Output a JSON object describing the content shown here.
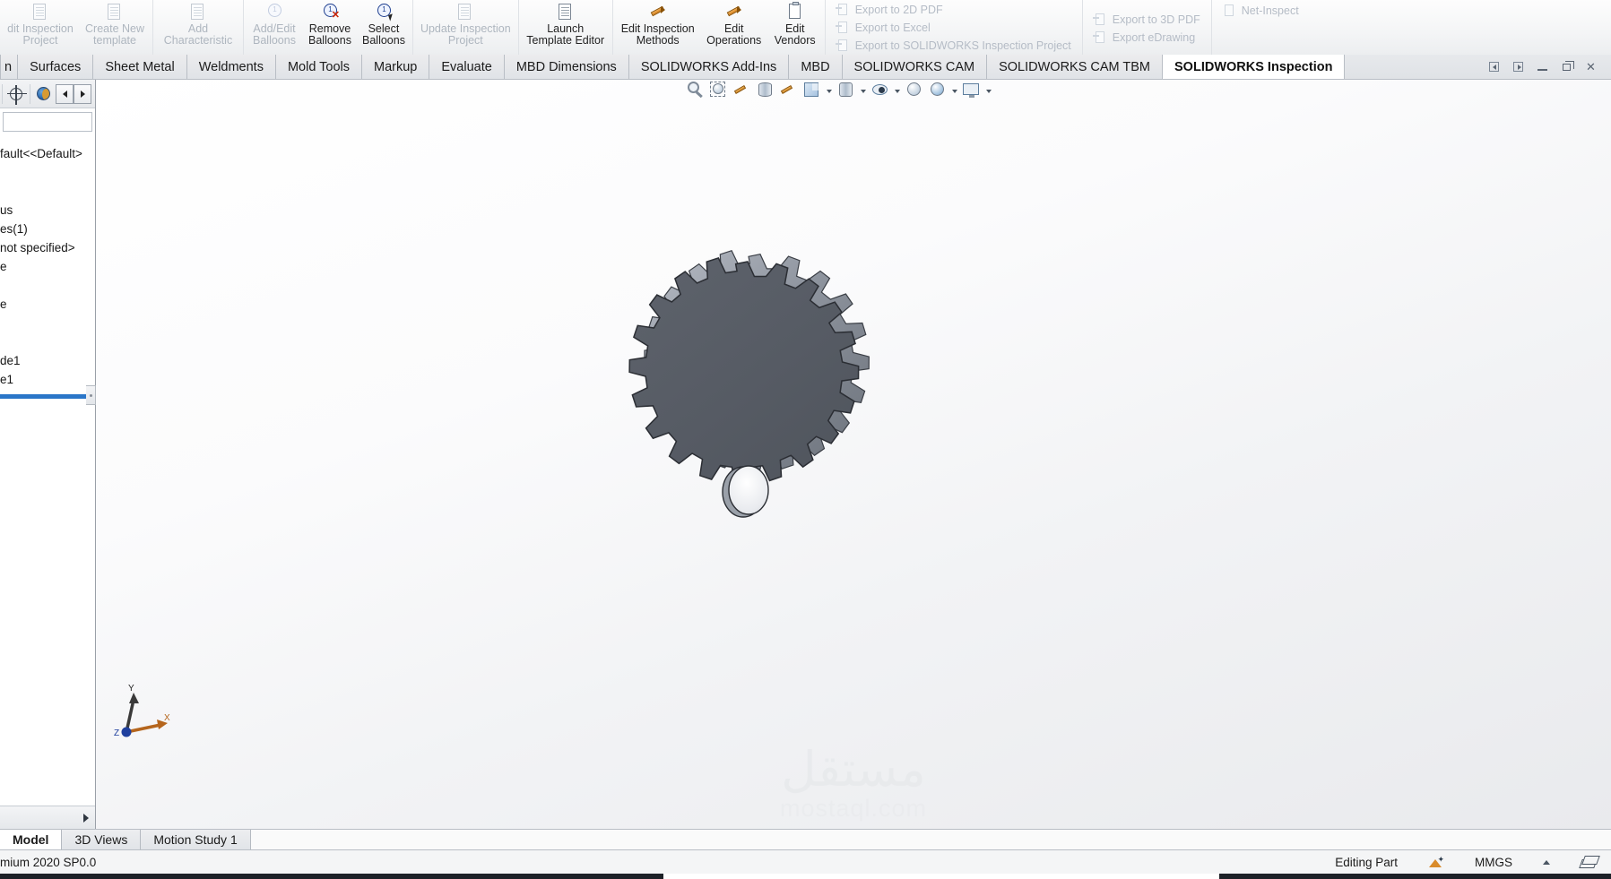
{
  "ribbon": {
    "groups": [
      {
        "name": "inspection-project-group",
        "buttons": [
          {
            "label": "dit Inspection\nProject",
            "icon": "edit-inspection-project-icon",
            "enabled": false
          },
          {
            "label": "Create New\ntemplate",
            "icon": "create-new-template-icon",
            "enabled": false
          }
        ]
      },
      {
        "name": "characteristic-group",
        "buttons": [
          {
            "label": "Add\nCharacteristic",
            "icon": "add-characteristic-icon",
            "enabled": false
          }
        ]
      },
      {
        "name": "balloons-group",
        "buttons": [
          {
            "label": "Add/Edit\nBalloons",
            "icon": "add-edit-balloons-icon",
            "enabled": false
          },
          {
            "label": "Remove\nBalloons",
            "icon": "remove-balloons-icon",
            "enabled": true
          },
          {
            "label": "Select\nBalloons",
            "icon": "select-balloons-icon",
            "enabled": true
          }
        ]
      },
      {
        "name": "update-group",
        "buttons": [
          {
            "label": "Update Inspection\nProject",
            "icon": "update-inspection-project-icon",
            "enabled": false
          }
        ]
      },
      {
        "name": "template-editor-group",
        "buttons": [
          {
            "label": "Launch\nTemplate Editor",
            "icon": "launch-template-editor-icon",
            "enabled": true
          }
        ]
      },
      {
        "name": "edit-group",
        "buttons": [
          {
            "label": "Edit Inspection\nMethods",
            "icon": "edit-inspection-methods-icon",
            "enabled": true
          },
          {
            "label": "Edit\nOperations",
            "icon": "edit-operations-icon",
            "enabled": true
          },
          {
            "label": "Edit\nVendors",
            "icon": "edit-vendors-icon",
            "enabled": true
          }
        ]
      }
    ],
    "export_column_1": [
      {
        "label": "Export to 2D PDF",
        "icon": "export-2d-pdf-icon",
        "enabled": false
      },
      {
        "label": "Export to Excel",
        "icon": "export-excel-icon",
        "enabled": false
      },
      {
        "label": "Export to SOLIDWORKS Inspection Project",
        "icon": "export-sw-inspection-icon",
        "enabled": false
      }
    ],
    "export_column_2": [
      {
        "label": "Export to 3D PDF",
        "icon": "export-3d-pdf-icon",
        "enabled": false
      },
      {
        "label": "Export eDrawing",
        "icon": "export-edrawing-icon",
        "enabled": false
      }
    ],
    "export_column_3": [
      {
        "label": "Net-Inspect",
        "icon": "net-inspect-icon",
        "enabled": false
      }
    ]
  },
  "tabs": {
    "items": [
      {
        "label": "n",
        "active": false,
        "partial": true
      },
      {
        "label": "Surfaces",
        "active": false
      },
      {
        "label": "Sheet Metal",
        "active": false
      },
      {
        "label": "Weldments",
        "active": false
      },
      {
        "label": "Mold Tools",
        "active": false
      },
      {
        "label": "Markup",
        "active": false
      },
      {
        "label": "Evaluate",
        "active": false
      },
      {
        "label": "MBD Dimensions",
        "active": false
      },
      {
        "label": "SOLIDWORKS Add-Ins",
        "active": false
      },
      {
        "label": "MBD",
        "active": false
      },
      {
        "label": "SOLIDWORKS CAM",
        "active": false
      },
      {
        "label": "SOLIDWORKS CAM TBM",
        "active": false
      },
      {
        "label": "SOLIDWORKS Inspection",
        "active": true
      }
    ],
    "window_controls": [
      {
        "name": "restore-prev-doc-button",
        "glyph": "prev"
      },
      {
        "name": "restore-next-doc-button",
        "glyph": "next"
      },
      {
        "name": "minimize-button",
        "glyph": "minimize"
      },
      {
        "name": "restore-button",
        "glyph": "restore"
      },
      {
        "name": "close-button",
        "glyph": "close"
      }
    ]
  },
  "left_panel": {
    "toolbar": {
      "nav_prev": "◀",
      "nav_next": "▶"
    },
    "tree_rows": [
      "fault<<Default>",
      "",
      "",
      "us",
      "es(1)",
      "not specified>",
      "e",
      "",
      "e",
      "",
      "",
      "de1",
      "e1"
    ]
  },
  "view_toolbar": {
    "icons": [
      {
        "name": "zoom-to-fit-icon",
        "dropdown": false
      },
      {
        "name": "zoom-to-area-icon",
        "dropdown": false
      },
      {
        "name": "section-view-icon",
        "dropdown": false
      },
      {
        "name": "view-orientation-cylinder-icon",
        "dropdown": false
      },
      {
        "name": "display-style-brush-icon",
        "dropdown": false
      },
      {
        "name": "view-orientation-icon",
        "dropdown": true
      },
      {
        "name": "display-style-icon",
        "dropdown": true
      },
      {
        "name": "hide-show-items-icon",
        "dropdown": true
      },
      {
        "name": "appearances-icon",
        "dropdown": false
      },
      {
        "name": "scene-icon",
        "dropdown": true
      },
      {
        "name": "view-settings-icon",
        "dropdown": true
      }
    ]
  },
  "model": {
    "name": "spur-gear",
    "teeth": 20,
    "face_color": "#585d66",
    "edge_color": "#2b2e34",
    "rim_light_color": "#c8ccd3",
    "bore_color": "#e8eaee"
  },
  "triad": {
    "x_label": "X",
    "y_label": "Y",
    "z_label": "Z",
    "x_color": "#b5651d",
    "y_color": "#3a3a3a",
    "z_color": "#1f3f9e"
  },
  "watermark": {
    "arabic": "مستقل",
    "latin": "mostaql.com"
  },
  "bottom_tabs": {
    "items": [
      {
        "label": "Model",
        "active": true
      },
      {
        "label": "3D Views",
        "active": false
      },
      {
        "label": "Motion Study 1",
        "active": false
      }
    ]
  },
  "status_bar": {
    "left_text": "mium 2020 SP0.0",
    "editing_state": "Editing Part",
    "units": "MMGS",
    "overlay_icon": "rebuild-icon",
    "caret_icon": "caret-up-icon",
    "layers_icon": "layers-icon"
  }
}
